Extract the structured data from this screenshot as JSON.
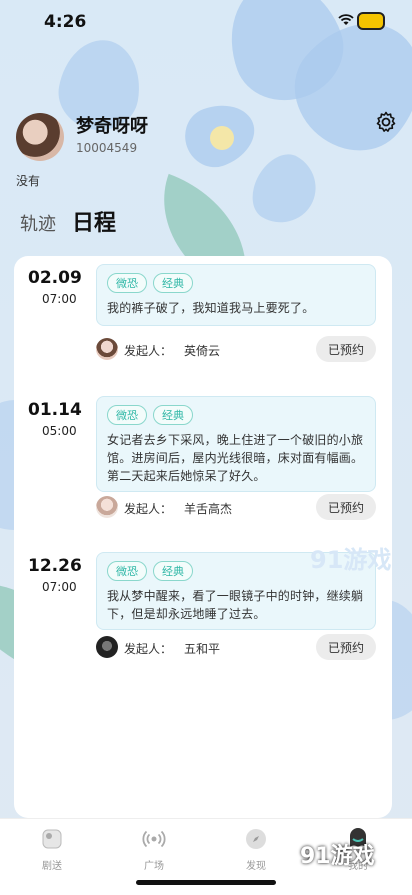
{
  "status": {
    "time": "4:26"
  },
  "profile": {
    "name": "梦奇呀呀",
    "id": "10004549",
    "bio": "没有"
  },
  "tabs": [
    {
      "label": "轨迹"
    },
    {
      "label": "日程"
    }
  ],
  "events": [
    {
      "date": "02.09",
      "time": "07:00",
      "tags": [
        "微恐",
        "经典"
      ],
      "text": "我的裤子破了，我知道我马上要死了。",
      "initiator_label": "发起人：",
      "initiator": "英倚云",
      "action": "已预约"
    },
    {
      "date": "01.14",
      "time": "05:00",
      "tags": [
        "微恐",
        "经典"
      ],
      "text": "女记者去乡下采风，晚上住进了一个破旧的小旅馆。进房间后，屋内光线很暗，床对面有幅画。第二天起来后她惊呆了好久。",
      "initiator_label": "发起人：",
      "initiator": "羊舌高杰",
      "action": "已预约"
    },
    {
      "date": "12.26",
      "time": "07:00",
      "tags": [
        "微恐",
        "经典"
      ],
      "text": "我从梦中醒来，看了一眼镜子中的时钟，继续躺下，但是却永远地睡了过去。",
      "initiator_label": "发起人：",
      "initiator": "五和平",
      "action": "已预约"
    }
  ],
  "nav": [
    {
      "label": "剧送",
      "icon": "home-icon"
    },
    {
      "label": "广场",
      "icon": "broadcast-icon"
    },
    {
      "label": "发现",
      "icon": "compass-icon"
    },
    {
      "label": "我的",
      "icon": "profile-icon"
    }
  ],
  "watermark": {
    "text": "91游戏",
    "url": "91danji.com"
  },
  "colors": {
    "accent": "#2fb7a6",
    "card_bg": "#eaf7fb"
  }
}
